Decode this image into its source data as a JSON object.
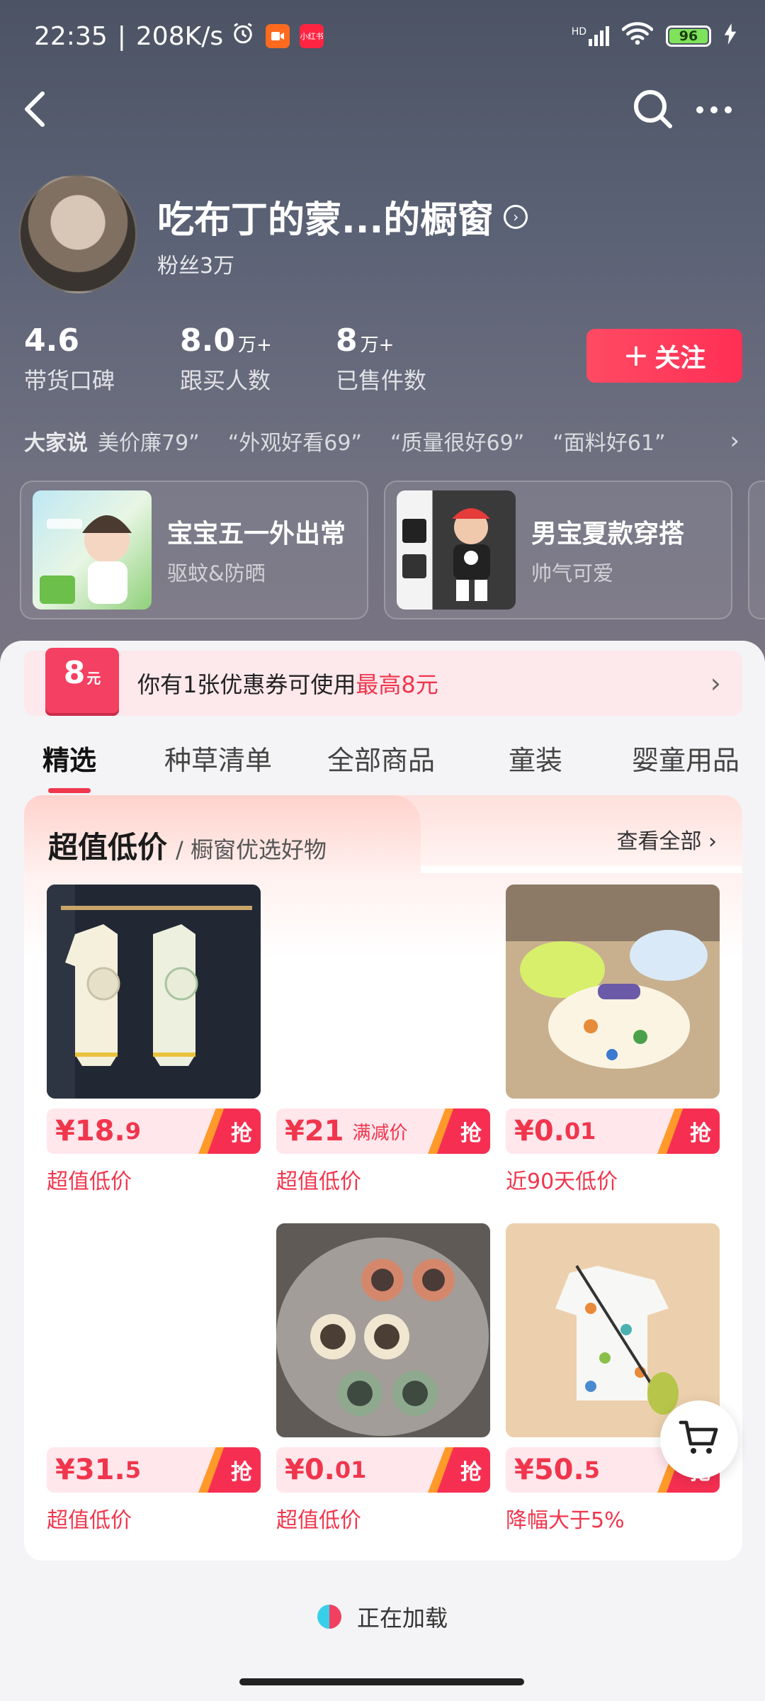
{
  "status_bar": {
    "time": "22:35",
    "speed": "208K/s",
    "app_badge": "小红书",
    "signal": "HD",
    "battery": "96"
  },
  "shop": {
    "name": "吃布丁的蒙...的橱窗",
    "fans": "粉丝3万",
    "follow_label": "关注"
  },
  "stats": [
    {
      "value": "4.6",
      "unit": "",
      "label": "带货口碑"
    },
    {
      "value": "8.0",
      "unit": "万+",
      "label": "跟买人数"
    },
    {
      "value": "8",
      "unit": "万+",
      "label": "已售件数"
    }
  ],
  "reviews": {
    "heading": "大家说",
    "items": [
      "美价廉79”",
      "“外观好看69”",
      "“质量很好69”",
      "“面料好61”"
    ]
  },
  "collections": [
    {
      "title": "宝宝五一外出常",
      "subtitle": "驱蚊&防晒"
    },
    {
      "title": "男宝夏款穿搭",
      "subtitle": "帅气可爱"
    }
  ],
  "coupon": {
    "amount": "8",
    "unit": "元",
    "text": "你有1张优惠券可使用",
    "highlight": "最高8元"
  },
  "tabs": [
    "精选",
    "种草清单",
    "全部商品",
    "童装",
    "婴童用品"
  ],
  "section": {
    "title": "超值低价",
    "subtitle": "/ 橱窗优选好物",
    "more": "查看全部"
  },
  "products": [
    {
      "price_main": "¥18.",
      "price_dec": "9",
      "tag": "",
      "grab": "抢",
      "label": "超值低价"
    },
    {
      "price_main": "¥21",
      "price_dec": "",
      "tag": "满减价",
      "grab": "抢",
      "label": "超值低价"
    },
    {
      "price_main": "¥0.",
      "price_dec": "01",
      "tag": "",
      "grab": "抢",
      "label": "近90天低价"
    },
    {
      "price_main": "¥31.",
      "price_dec": "5",
      "tag": "",
      "grab": "抢",
      "label": "超值低价"
    },
    {
      "price_main": "¥0.",
      "price_dec": "01",
      "tag": "",
      "grab": "抢",
      "label": "超值低价"
    },
    {
      "price_main": "¥50.",
      "price_dec": "5",
      "tag": "",
      "grab": "抢",
      "label": "降幅大于5%"
    }
  ],
  "loading_text": "正在加载"
}
